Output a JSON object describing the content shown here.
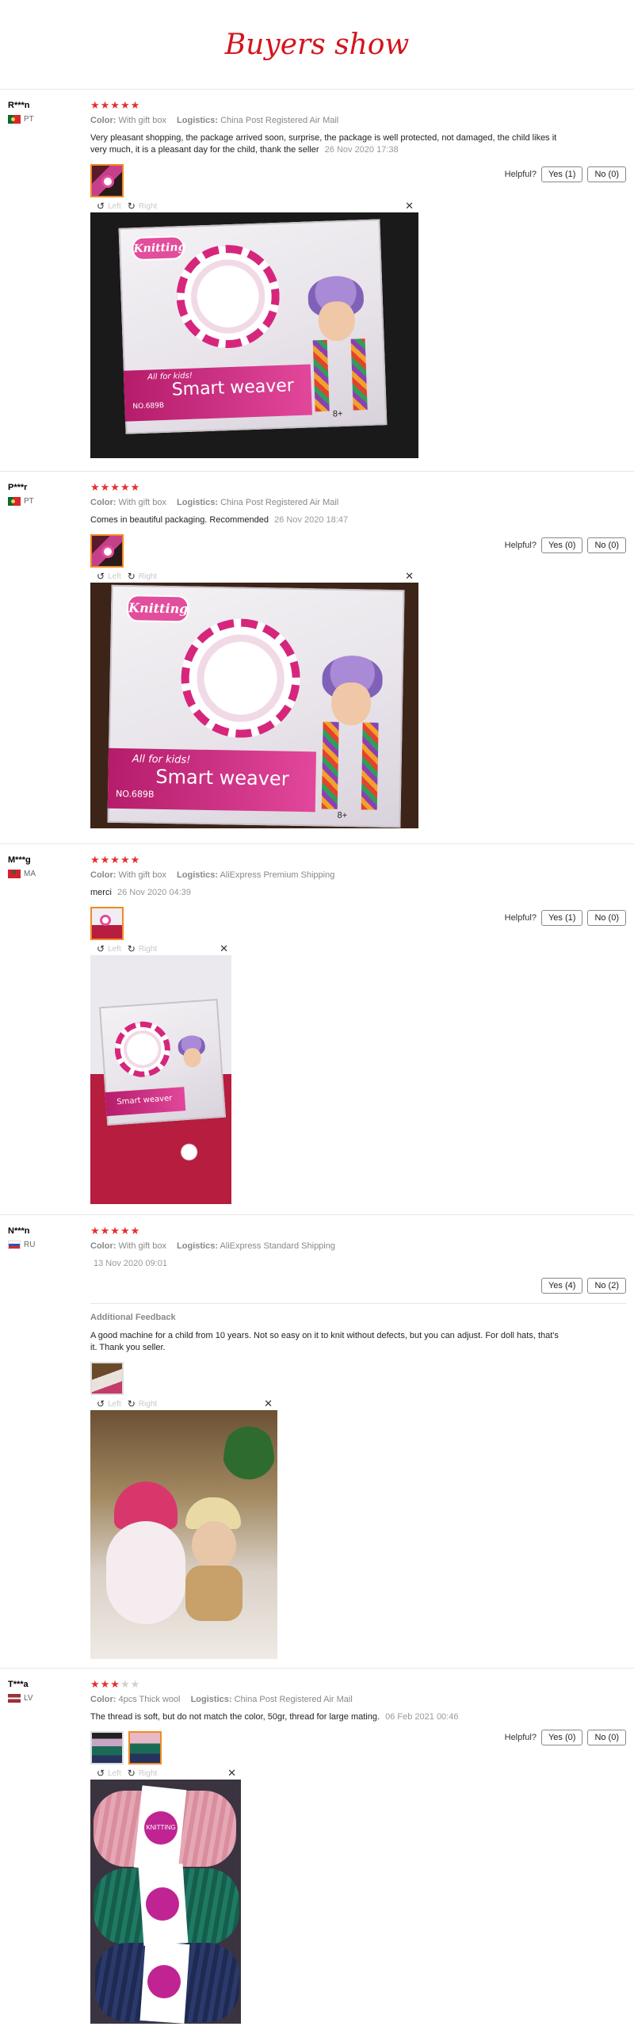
{
  "page": {
    "title": "Buyers show"
  },
  "viewer": {
    "left_label": "Left",
    "right_label": "Right"
  },
  "labels": {
    "color_key": "Color:",
    "logistics_key": "Logistics:",
    "helpful": "Helpful?",
    "additional_feedback": "Additional Feedback"
  },
  "reviews": [
    {
      "user": "R***n",
      "country": "PT",
      "stars": 5,
      "color": "With gift box",
      "logistics": "China Post Registered Air Mail",
      "text": "Very pleasant shopping, the package arrived soon, surprise, the package is well protected, not damaged, the child likes it very much, it is a pleasant day for the child, thank the seller",
      "date": "26 Nov 2020 17:38",
      "yes": "Yes (1)",
      "no": "No (0)",
      "box_logo": "Knitting",
      "box_banner_small": "All for kids!",
      "box_banner_big": "Smart weaver",
      "box_code": "NO.689B",
      "box_age": "8+"
    },
    {
      "user": "P***r",
      "country": "PT",
      "stars": 5,
      "color": "With gift box",
      "logistics": "China Post Registered Air Mail",
      "text": "Comes in beautiful packaging. Recommended",
      "date": "26 Nov 2020 18:47",
      "yes": "Yes (0)",
      "no": "No (0)",
      "box_logo": "Knitting",
      "box_banner_small": "All for kids!",
      "box_banner_big": "Smart weaver",
      "box_code": "NO.689B",
      "box_age": "8+"
    },
    {
      "user": "M***g",
      "country": "MA",
      "stars": 5,
      "color": "With gift box",
      "logistics": "AliExpress Premium Shipping",
      "text": "merci",
      "date": "26 Nov 2020 04:39",
      "yes": "Yes (1)",
      "no": "No (0)",
      "box_banner_big": "Smart weaver"
    },
    {
      "user": "N***n",
      "country": "RU",
      "stars": 5,
      "color": "With gift box",
      "logistics": "AliExpress Standard Shipping",
      "text": "",
      "date": "13 Nov 2020 09:01",
      "yes": "Yes (4)",
      "no": "No (2)",
      "additional_text": "A good machine for a child from 10 years. Not so easy on it to knit without defects, but you can adjust. For doll hats, that's it. Thank you seller."
    },
    {
      "user": "T***a",
      "country": "LV",
      "stars": 3,
      "color": "4pcs Thick wool",
      "logistics": "China Post Registered Air Mail",
      "text": "The thread is soft, but do not match the color, 50gr, thread for large mating.",
      "date": "06 Feb 2021 00:46",
      "yes": "Yes (0)",
      "no": "No (0)",
      "yarn_label": "KNITTING"
    }
  ],
  "icons": {
    "star": "star-icon",
    "rotate_left": "rotate-left-icon",
    "rotate_right": "rotate-right-icon",
    "close": "close-icon",
    "flag": "flag-icon"
  },
  "colors": {
    "title_red": "#d4141c",
    "star_red": "#e62e2e",
    "thumb_border": "#f08a24",
    "product_pink": "#e24d9c"
  }
}
